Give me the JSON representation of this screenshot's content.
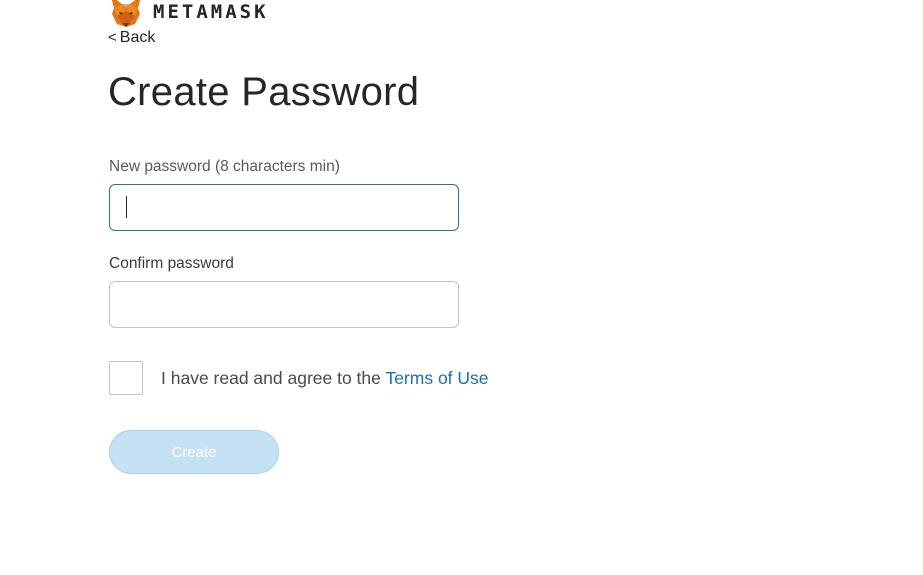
{
  "header": {
    "logo_icon": "fox-icon",
    "brand_wordmark": "METAMASK"
  },
  "nav": {
    "back_chevron": "<",
    "back_label": "Back"
  },
  "page": {
    "title": "Create Password"
  },
  "form": {
    "new_password": {
      "label": "New password (8 characters min)",
      "value": "",
      "focused": true
    },
    "confirm_password": {
      "label": "Confirm password",
      "value": ""
    },
    "terms": {
      "checked": false,
      "prefix": "I have read and agree to the ",
      "link_label": "Terms of Use"
    },
    "submit": {
      "label": "Create",
      "enabled": false
    }
  },
  "colors": {
    "link": "#1f6fa8",
    "focus_border": "#2f6f9f",
    "button_disabled_bg": "#c5e1f4",
    "fox_orange": "#e2761b"
  }
}
